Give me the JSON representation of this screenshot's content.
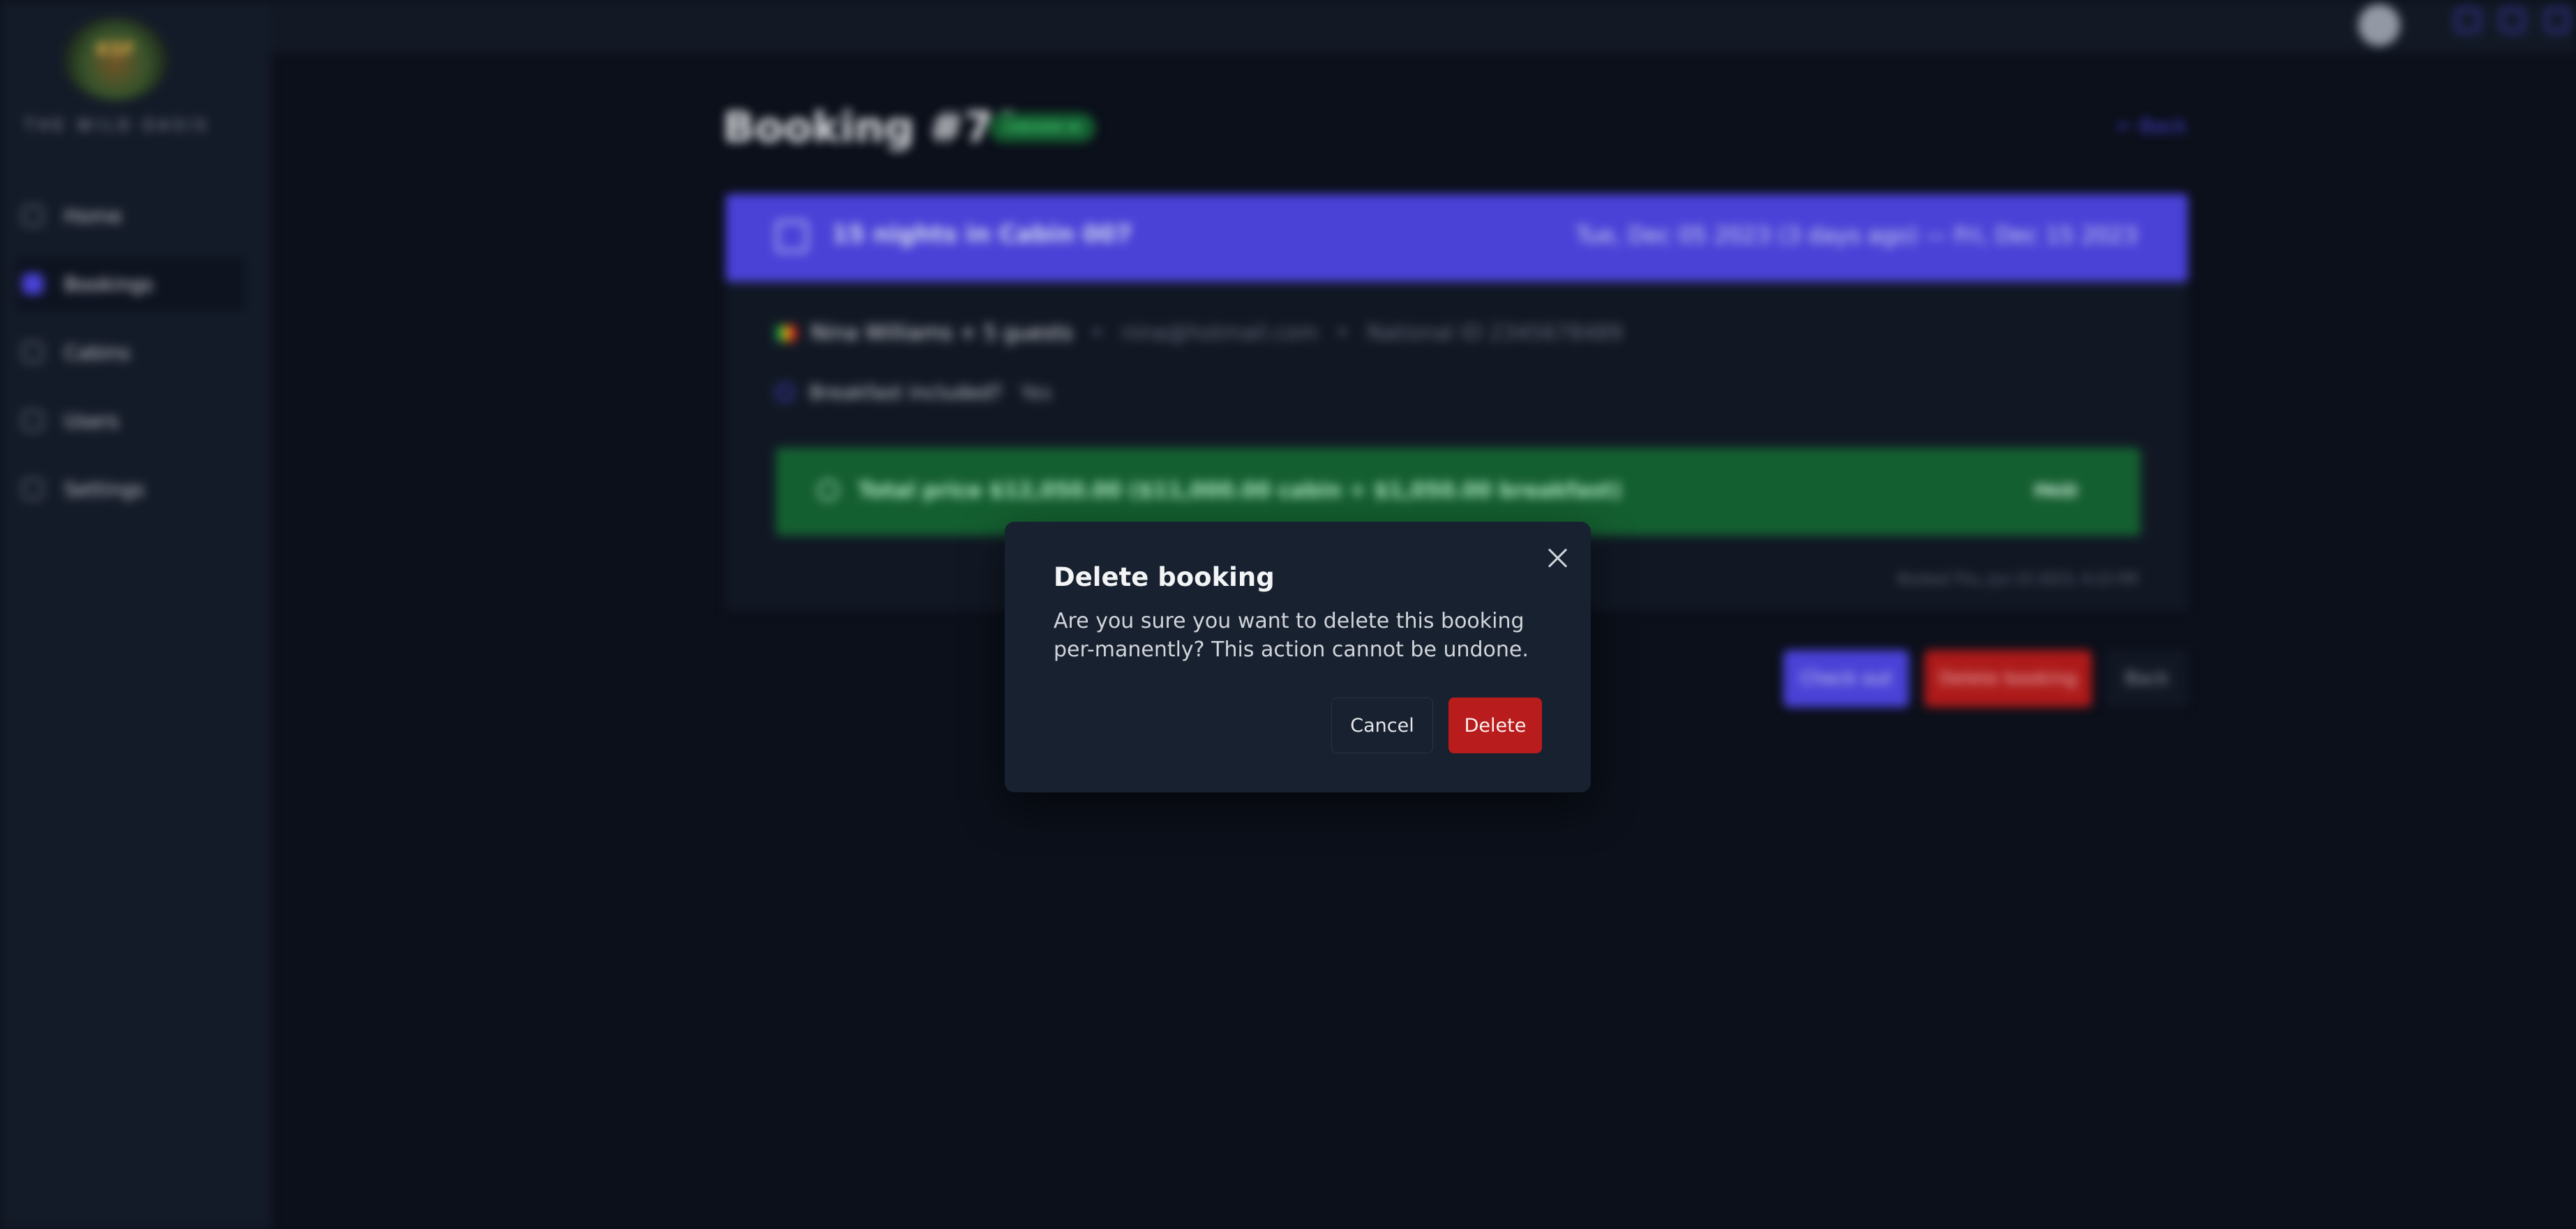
{
  "sidebar": {
    "logo_text": "KSF",
    "brand": "THE WILD OASIS",
    "items": [
      {
        "label": "Home",
        "icon": "home-icon"
      },
      {
        "label": "Bookings",
        "icon": "calendar-icon",
        "active": true
      },
      {
        "label": "Cabins",
        "icon": "cabin-icon"
      },
      {
        "label": "Users",
        "icon": "users-icon"
      },
      {
        "label": "Settings",
        "icon": "gear-icon"
      }
    ]
  },
  "header": {
    "icons": [
      "user-icon",
      "moon-icon",
      "logout-icon"
    ]
  },
  "booking": {
    "title": "Booking #70",
    "status": "CHECKED IN",
    "back_link": "← Back",
    "banner_left": "15 nights in Cabin 007",
    "banner_right": "Tue, Dec 05 2023 (3 days ago) — Fri, Dec 15 2023",
    "guest_name": "Nina Williams + 5 guests",
    "guest_email": "nina@hotmail.com",
    "guest_national_id": "National ID 2345678489",
    "breakfast_label": "Breakfast included?",
    "breakfast_value": "Yes",
    "price_text": "Total price  $12,050.00 ($11,000.00 cabin + $1,050.00 breakfast)",
    "paid_label": "PAID",
    "booked_at": "Booked Thu, Jun 15 2023, 4:15 PM",
    "actions": {
      "check_out": "Check out",
      "delete": "Delete booking",
      "back": "Back"
    }
  },
  "modal": {
    "title": "Delete booking",
    "body": "Are you sure you want to delete this booking per-manently? This action cannot be undone.",
    "cancel": "Cancel",
    "delete": "Delete"
  },
  "colors": {
    "accent": "#4f46e5",
    "danger": "#b91c1c",
    "success": "#166534",
    "background": "#0c111c"
  }
}
